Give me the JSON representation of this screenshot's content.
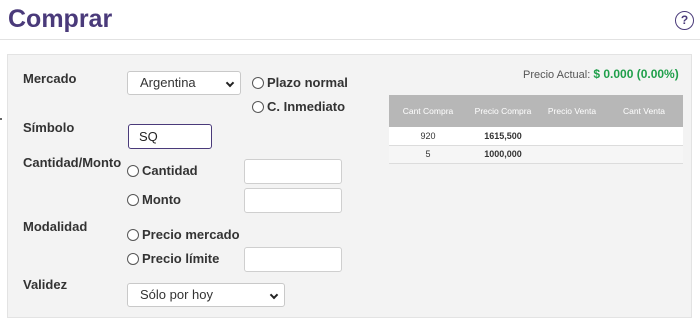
{
  "header": {
    "title": "Comprar",
    "help_glyph": "?"
  },
  "form": {
    "mercado_label": "Mercado",
    "mercado_value": "Argentina",
    "plazo_options": [
      "Plazo normal",
      "C. Inmediato"
    ],
    "simbolo_label": "Símbolo",
    "simbolo_value": "SQ",
    "cantidad_monto_label": "Cantidad/Monto",
    "cantidad_label": "Cantidad",
    "monto_label": "Monto",
    "modalidad_label": "Modalidad",
    "precio_mercado_label": "Precio mercado",
    "precio_limite_label": "Precio límite",
    "validez_label": "Validez",
    "validez_value": "Sólo por hoy"
  },
  "quote": {
    "label": "Precio Actual:",
    "value": "$ 0.000 (0.00%)",
    "value_color": "#1f9f4a"
  },
  "order_book": {
    "headers": [
      "Cant Compra",
      "Precio Compra",
      "Precio Venta",
      "Cant Venta"
    ],
    "rows": [
      [
        "920",
        "1615,500",
        "",
        ""
      ],
      [
        "5",
        "1000,000",
        "",
        ""
      ]
    ]
  },
  "colors": {
    "title": "#4a3a7a",
    "table_header": "#b7b7b7",
    "panel_bg": "#f3f3f3"
  }
}
